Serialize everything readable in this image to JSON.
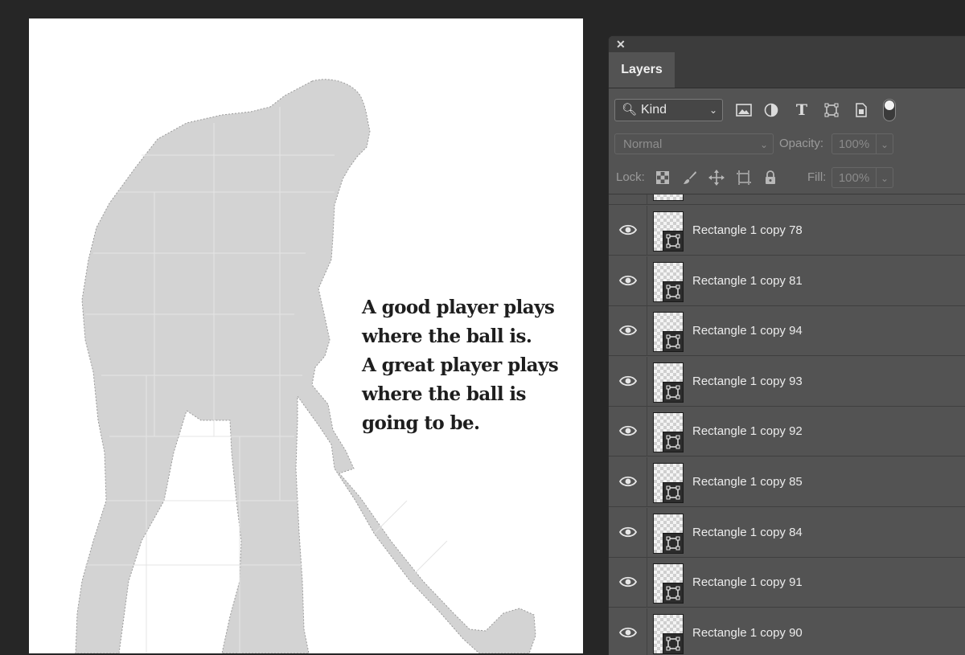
{
  "canvas": {
    "quote_lines": [
      "A good player plays",
      "where the ball is.",
      "A great player plays",
      "where the ball is",
      "going to be."
    ],
    "colors": {
      "silhouette": "#d3d3d3",
      "quote_text": "#1e1e1e",
      "canvas_bg": "#ffffff"
    }
  },
  "panel": {
    "close_icon": "close-icon",
    "tab_label": "Layers",
    "filter": {
      "kind_label": "Kind",
      "icons": [
        "image-filter-icon",
        "adjustment-filter-icon",
        "type-filter-icon",
        "shape-filter-icon",
        "smart-object-filter-icon"
      ]
    },
    "blend_mode": "Normal",
    "opacity_label": "Opacity:",
    "opacity_value": "100%",
    "lock_label": "Lock:",
    "lock_icons": [
      "lock-transparent-icon",
      "lock-paint-icon",
      "lock-position-icon",
      "lock-artboard-icon",
      "lock-all-icon"
    ],
    "fill_label": "Fill:",
    "fill_value": "100%",
    "layers": [
      {
        "name": "Rectangle 1 copy 78",
        "visible": true
      },
      {
        "name": "Rectangle 1 copy 81",
        "visible": true
      },
      {
        "name": "Rectangle 1 copy 94",
        "visible": true
      },
      {
        "name": "Rectangle 1 copy 93",
        "visible": true
      },
      {
        "name": "Rectangle 1 copy 92",
        "visible": true
      },
      {
        "name": "Rectangle 1 copy 85",
        "visible": true
      },
      {
        "name": "Rectangle 1 copy 84",
        "visible": true
      },
      {
        "name": "Rectangle 1 copy 91",
        "visible": true
      },
      {
        "name": "Rectangle 1 copy 90",
        "visible": true
      }
    ]
  }
}
